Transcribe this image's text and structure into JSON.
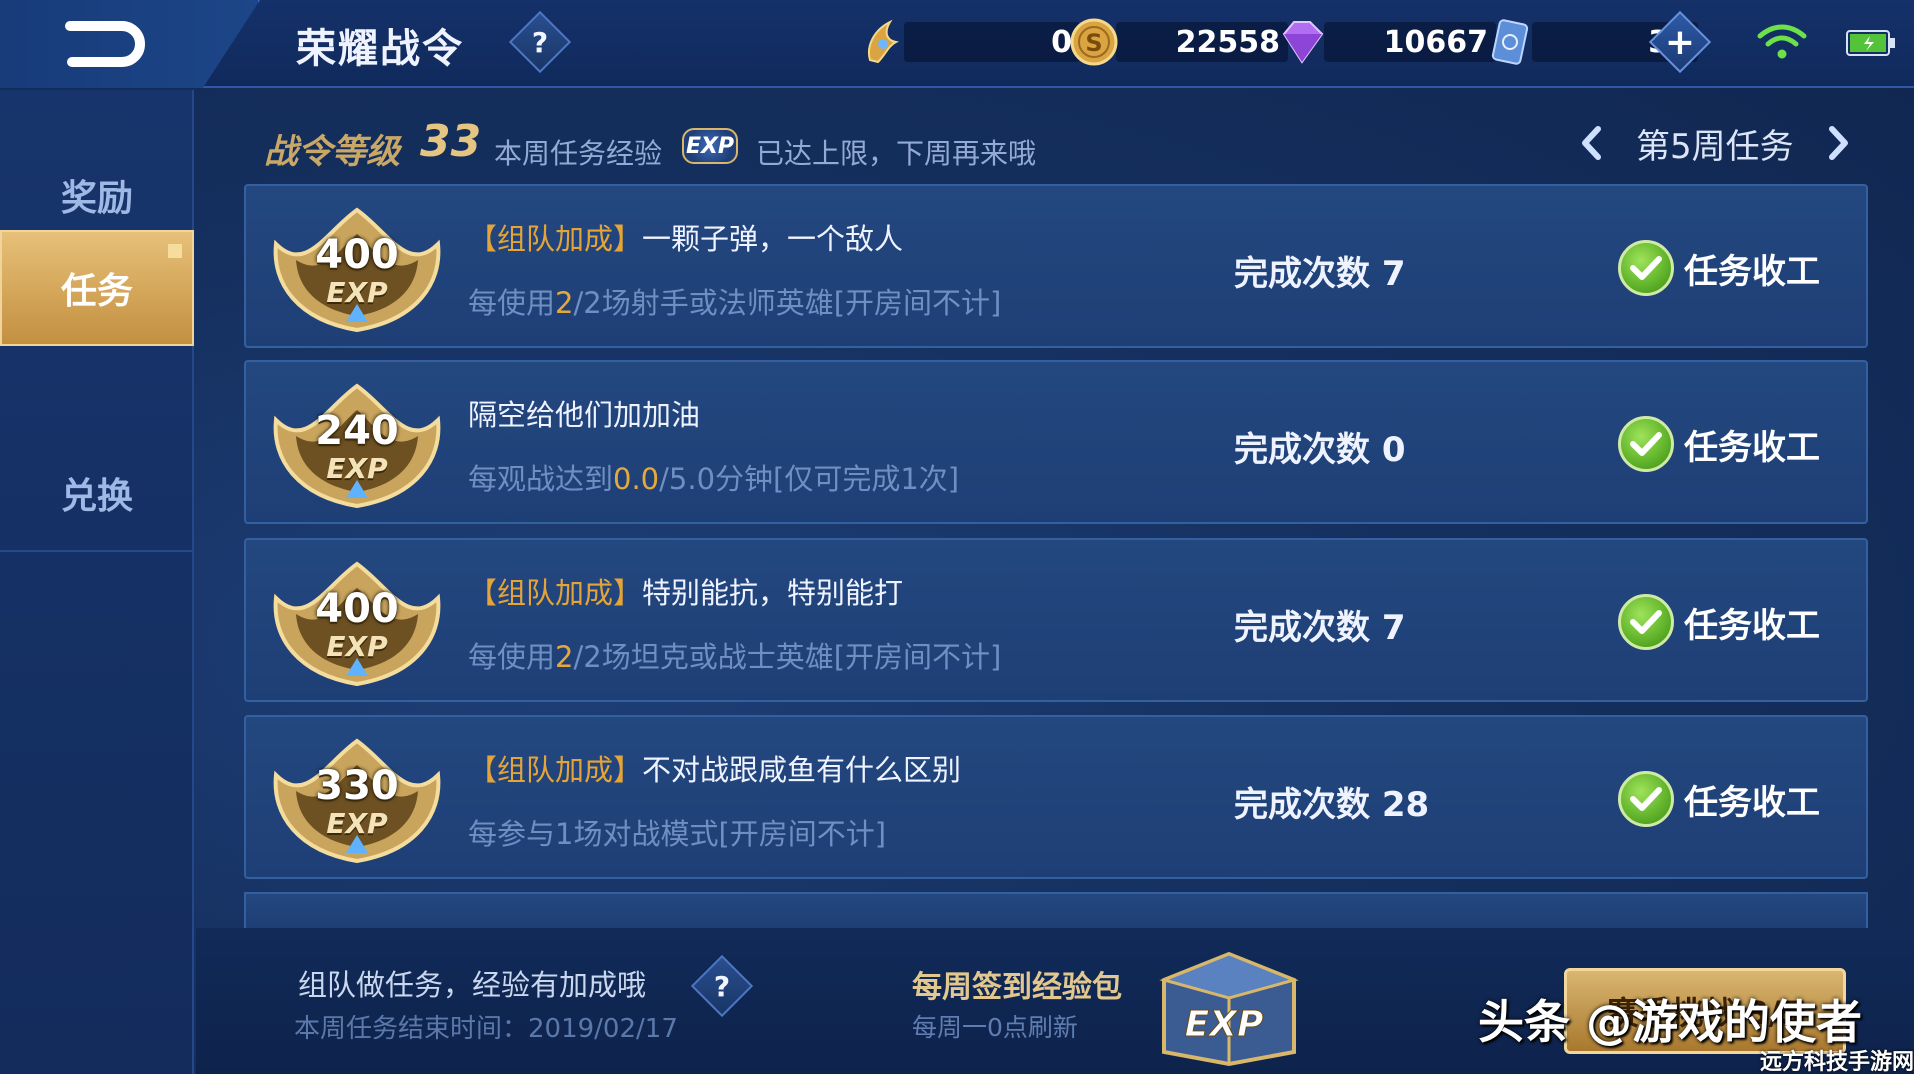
{
  "header": {
    "title": "荣耀战令",
    "help": "?",
    "resources": [
      {
        "icon": "battle-token-icon",
        "value": "0"
      },
      {
        "icon": "gold-coin-icon",
        "value": "22558"
      },
      {
        "icon": "diamond-icon",
        "value": "10667"
      },
      {
        "icon": "voucher-card-icon",
        "value": "38"
      }
    ],
    "plus": "+"
  },
  "sidebar": {
    "items": [
      {
        "label": "奖励",
        "active": false
      },
      {
        "label": "任务",
        "active": true
      },
      {
        "label": "兑换",
        "active": false
      }
    ]
  },
  "status": {
    "level_label": "战令等级",
    "level": "33",
    "note_before": "本周任务经验",
    "exp_chip": "EXP",
    "note_after": "已达上限，下周再来哦",
    "week": "第5周任务"
  },
  "tasks": [
    {
      "exp": "400",
      "exp_unit": "EXP",
      "bracket": "【组队加成】",
      "title": "一颗子弹，一个敌人",
      "desc_pre": "每使用",
      "desc_hl": "2",
      "desc_mid": "/2场射手或法师英雄[开房间不计]",
      "count_label": "完成次数",
      "count": "7",
      "status": "任务收工"
    },
    {
      "exp": "240",
      "exp_unit": "EXP",
      "bracket": "",
      "title": "隔空给他们加加油",
      "desc_pre": "每观战达到",
      "desc_hl": "0.0",
      "desc_mid": "/5.0分钟[仅可完成1次]",
      "count_label": "完成次数",
      "count": "0",
      "status": "任务收工"
    },
    {
      "exp": "400",
      "exp_unit": "EXP",
      "bracket": "【组队加成】",
      "title": "特别能抗，特别能打",
      "desc_pre": "每使用",
      "desc_hl": "2",
      "desc_mid": "/2场坦克或战士英雄[开房间不计]",
      "count_label": "完成次数",
      "count": "7",
      "status": "任务收工"
    },
    {
      "exp": "330",
      "exp_unit": "EXP",
      "bracket": "【组队加成】",
      "title": "不对战跟咸鱼有什么区别",
      "desc_pre": "每参与1场对战模式[开房间不计]",
      "desc_hl": "",
      "desc_mid": "",
      "count_label": "完成次数",
      "count": "28",
      "status": "任务收工"
    }
  ],
  "footer": {
    "tip": "组队做任务，经验有加成哦",
    "help": "?",
    "end_time": "本周任务结束时间：2019/02/17",
    "pack_title": "每周签到经验包",
    "pack_sub": "每周一0点刷新",
    "chest_label": "EXP",
    "season_button": "赛季挑战 3/5"
  },
  "watermark": "头条 @游戏的使者",
  "watermark2": "远方科技手游网"
}
